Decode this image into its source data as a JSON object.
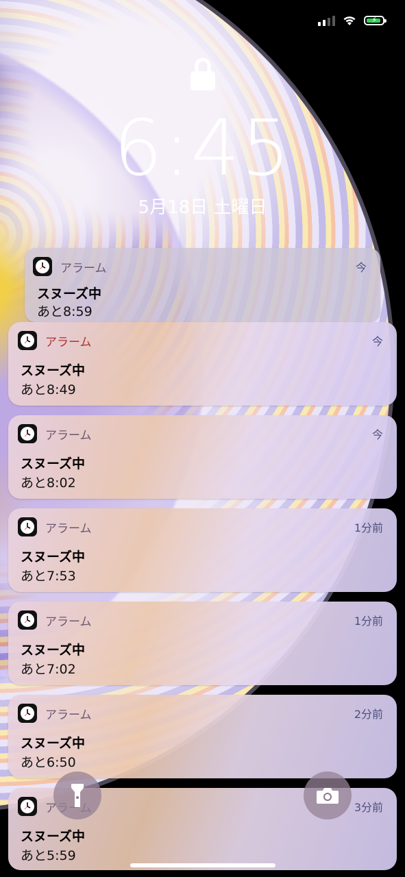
{
  "status": {
    "signal_icon": "cellular-signal-icon",
    "wifi_icon": "wifi-icon",
    "battery_icon": "battery-charging-icon",
    "battery_color": "#33d35a"
  },
  "lock": {
    "icon": "lock-icon",
    "time": "6:45",
    "date": "5月18日 土曜日"
  },
  "notifications": [
    {
      "app": "アラーム",
      "time": "今",
      "title": "スヌーズ中",
      "body": "あと8:59"
    },
    {
      "app": "アラーム",
      "time": "今",
      "title": "スヌーズ中",
      "body": "あと8:49"
    },
    {
      "app": "アラーム",
      "time": "今",
      "title": "スヌーズ中",
      "body": "あと8:02"
    },
    {
      "app": "アラーム",
      "time": "1分前",
      "title": "スヌーズ中",
      "body": "あと7:53"
    },
    {
      "app": "アラーム",
      "time": "1分前",
      "title": "スヌーズ中",
      "body": "あと7:02"
    },
    {
      "app": "アラーム",
      "time": "2分前",
      "title": "スヌーズ中",
      "body": "あと6:50"
    },
    {
      "app": "アラーム",
      "time": "3分前",
      "title": "スヌーズ中",
      "body": "あと5:59"
    }
  ],
  "controls": {
    "flashlight_icon": "flashlight-icon",
    "camera_icon": "camera-icon"
  }
}
